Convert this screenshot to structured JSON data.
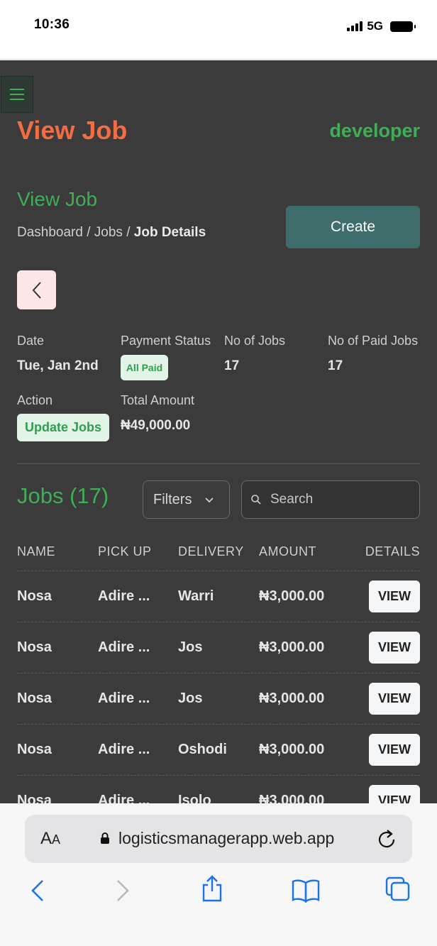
{
  "status_bar": {
    "time": "10:36",
    "network": "5G"
  },
  "header": {
    "title": "View Job",
    "user": "developer"
  },
  "section": {
    "title": "View Job",
    "breadcrumb": {
      "item1": "Dashboard",
      "sep1": " / ",
      "item2": "Jobs",
      "sep2": " / ",
      "current": "Job Details"
    },
    "create_label": "Create"
  },
  "summary": {
    "date_label": "Date",
    "date_value": "Tue, Jan 2nd",
    "payment_label": "Payment Status",
    "payment_value": "All Paid",
    "jobs_label": "No of Jobs",
    "jobs_value": "17",
    "paid_label": "No of Paid Jobs",
    "paid_value": "17",
    "action_label": "Action",
    "action_button": "Update Jobs",
    "total_label": "Total Amount",
    "total_value": "₦49,000.00"
  },
  "jobs": {
    "title": "Jobs (17)",
    "filters_label": "Filters",
    "search_placeholder": "Search",
    "columns": [
      "NAME",
      "PICK UP",
      "DELIVERY",
      "AMOUNT",
      "DETAILS"
    ],
    "view_label": "VIEW",
    "rows": [
      {
        "name": "Nosa",
        "pickup": "Adire ...",
        "delivery": "Warri",
        "amount": "₦3,000.00"
      },
      {
        "name": "Nosa",
        "pickup": "Adire ...",
        "delivery": "Jos",
        "amount": "₦3,000.00"
      },
      {
        "name": "Nosa",
        "pickup": "Adire ...",
        "delivery": "Jos",
        "amount": "₦3,000.00"
      },
      {
        "name": "Nosa",
        "pickup": "Adire ...",
        "delivery": "Oshodi",
        "amount": "₦3,000.00"
      },
      {
        "name": "Nosa",
        "pickup": "Adire ...",
        "delivery": "Isolo",
        "amount": "₦3,000.00"
      }
    ]
  },
  "browser": {
    "aa_big": "A",
    "aa_small": "A",
    "url": "logisticsmanagerapp.web.app"
  },
  "icons": {
    "menu": "hamburger-icon",
    "back": "chevron-left-icon",
    "filters": "chevron-down-icon",
    "search": "search-icon",
    "lock": "lock-icon",
    "reload": "reload-icon",
    "nav_back": "back-arrow-icon",
    "nav_forward": "forward-arrow-icon",
    "share": "share-icon",
    "bookmarks": "bookmarks-icon",
    "tabs": "tabs-icon"
  },
  "colors": {
    "background": "#3b3b3b",
    "accent_green": "#3fae57",
    "title_orange": "#f26d43",
    "create_button": "#3f6d6c",
    "browser_blue": "#1a73e8"
  }
}
